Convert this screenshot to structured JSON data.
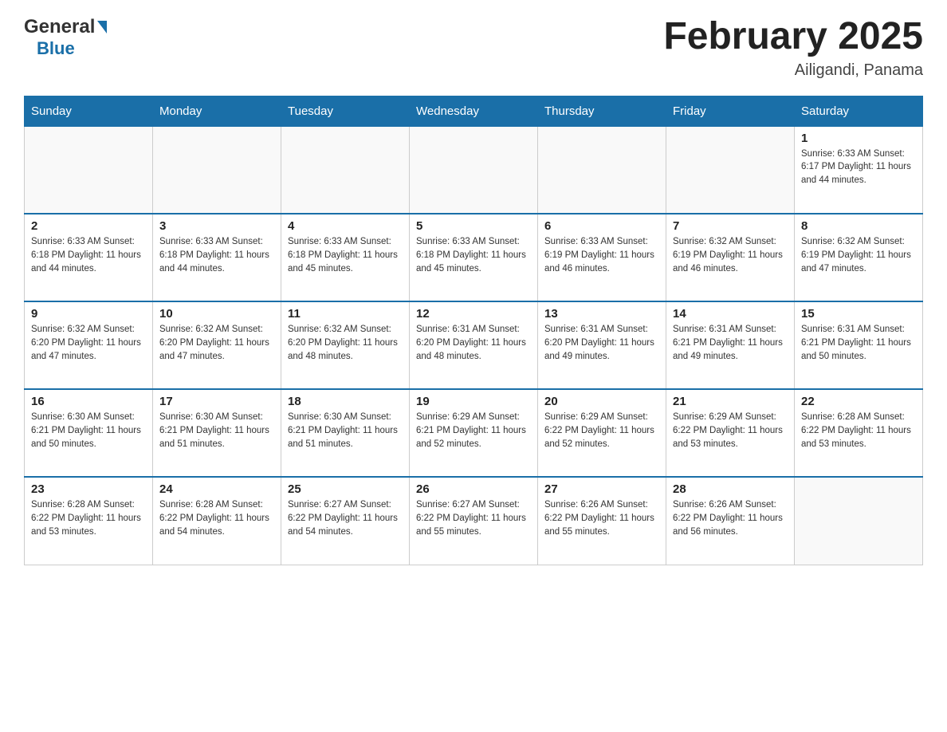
{
  "header": {
    "logo_general": "General",
    "logo_blue": "Blue",
    "title": "February 2025",
    "subtitle": "Ailigandi, Panama"
  },
  "days_of_week": [
    "Sunday",
    "Monday",
    "Tuesday",
    "Wednesday",
    "Thursday",
    "Friday",
    "Saturday"
  ],
  "weeks": [
    [
      {
        "day": "",
        "info": ""
      },
      {
        "day": "",
        "info": ""
      },
      {
        "day": "",
        "info": ""
      },
      {
        "day": "",
        "info": ""
      },
      {
        "day": "",
        "info": ""
      },
      {
        "day": "",
        "info": ""
      },
      {
        "day": "1",
        "info": "Sunrise: 6:33 AM\nSunset: 6:17 PM\nDaylight: 11 hours\nand 44 minutes."
      }
    ],
    [
      {
        "day": "2",
        "info": "Sunrise: 6:33 AM\nSunset: 6:18 PM\nDaylight: 11 hours\nand 44 minutes."
      },
      {
        "day": "3",
        "info": "Sunrise: 6:33 AM\nSunset: 6:18 PM\nDaylight: 11 hours\nand 44 minutes."
      },
      {
        "day": "4",
        "info": "Sunrise: 6:33 AM\nSunset: 6:18 PM\nDaylight: 11 hours\nand 45 minutes."
      },
      {
        "day": "5",
        "info": "Sunrise: 6:33 AM\nSunset: 6:18 PM\nDaylight: 11 hours\nand 45 minutes."
      },
      {
        "day": "6",
        "info": "Sunrise: 6:33 AM\nSunset: 6:19 PM\nDaylight: 11 hours\nand 46 minutes."
      },
      {
        "day": "7",
        "info": "Sunrise: 6:32 AM\nSunset: 6:19 PM\nDaylight: 11 hours\nand 46 minutes."
      },
      {
        "day": "8",
        "info": "Sunrise: 6:32 AM\nSunset: 6:19 PM\nDaylight: 11 hours\nand 47 minutes."
      }
    ],
    [
      {
        "day": "9",
        "info": "Sunrise: 6:32 AM\nSunset: 6:20 PM\nDaylight: 11 hours\nand 47 minutes."
      },
      {
        "day": "10",
        "info": "Sunrise: 6:32 AM\nSunset: 6:20 PM\nDaylight: 11 hours\nand 47 minutes."
      },
      {
        "day": "11",
        "info": "Sunrise: 6:32 AM\nSunset: 6:20 PM\nDaylight: 11 hours\nand 48 minutes."
      },
      {
        "day": "12",
        "info": "Sunrise: 6:31 AM\nSunset: 6:20 PM\nDaylight: 11 hours\nand 48 minutes."
      },
      {
        "day": "13",
        "info": "Sunrise: 6:31 AM\nSunset: 6:20 PM\nDaylight: 11 hours\nand 49 minutes."
      },
      {
        "day": "14",
        "info": "Sunrise: 6:31 AM\nSunset: 6:21 PM\nDaylight: 11 hours\nand 49 minutes."
      },
      {
        "day": "15",
        "info": "Sunrise: 6:31 AM\nSunset: 6:21 PM\nDaylight: 11 hours\nand 50 minutes."
      }
    ],
    [
      {
        "day": "16",
        "info": "Sunrise: 6:30 AM\nSunset: 6:21 PM\nDaylight: 11 hours\nand 50 minutes."
      },
      {
        "day": "17",
        "info": "Sunrise: 6:30 AM\nSunset: 6:21 PM\nDaylight: 11 hours\nand 51 minutes."
      },
      {
        "day": "18",
        "info": "Sunrise: 6:30 AM\nSunset: 6:21 PM\nDaylight: 11 hours\nand 51 minutes."
      },
      {
        "day": "19",
        "info": "Sunrise: 6:29 AM\nSunset: 6:21 PM\nDaylight: 11 hours\nand 52 minutes."
      },
      {
        "day": "20",
        "info": "Sunrise: 6:29 AM\nSunset: 6:22 PM\nDaylight: 11 hours\nand 52 minutes."
      },
      {
        "day": "21",
        "info": "Sunrise: 6:29 AM\nSunset: 6:22 PM\nDaylight: 11 hours\nand 53 minutes."
      },
      {
        "day": "22",
        "info": "Sunrise: 6:28 AM\nSunset: 6:22 PM\nDaylight: 11 hours\nand 53 minutes."
      }
    ],
    [
      {
        "day": "23",
        "info": "Sunrise: 6:28 AM\nSunset: 6:22 PM\nDaylight: 11 hours\nand 53 minutes."
      },
      {
        "day": "24",
        "info": "Sunrise: 6:28 AM\nSunset: 6:22 PM\nDaylight: 11 hours\nand 54 minutes."
      },
      {
        "day": "25",
        "info": "Sunrise: 6:27 AM\nSunset: 6:22 PM\nDaylight: 11 hours\nand 54 minutes."
      },
      {
        "day": "26",
        "info": "Sunrise: 6:27 AM\nSunset: 6:22 PM\nDaylight: 11 hours\nand 55 minutes."
      },
      {
        "day": "27",
        "info": "Sunrise: 6:26 AM\nSunset: 6:22 PM\nDaylight: 11 hours\nand 55 minutes."
      },
      {
        "day": "28",
        "info": "Sunrise: 6:26 AM\nSunset: 6:22 PM\nDaylight: 11 hours\nand 56 minutes."
      },
      {
        "day": "",
        "info": ""
      }
    ]
  ]
}
